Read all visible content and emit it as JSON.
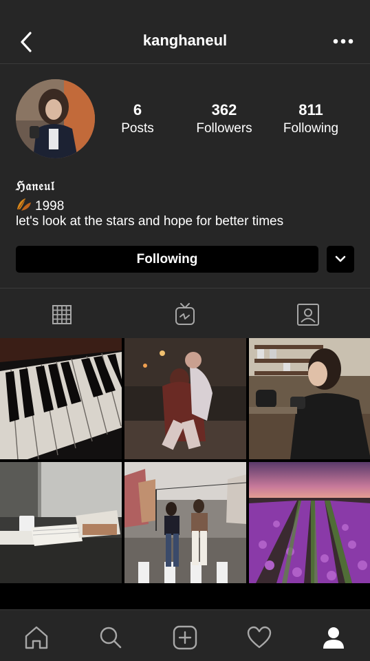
{
  "header": {
    "username": "kanghaneul",
    "back_icon": "chevron-left-icon",
    "more_icon": "more-horizontal-icon"
  },
  "profile": {
    "stats": [
      {
        "value": "6",
        "label": "Posts"
      },
      {
        "value": "362",
        "label": "Followers"
      },
      {
        "value": "811",
        "label": "Following"
      }
    ],
    "bio": {
      "name": "ℌ𝔞𝔫𝔢𝔲𝔩",
      "birth_year_line": "1998",
      "bio_emoji": "fallen-leaf-emoji",
      "tagline": "let's look at the stars and hope for better times"
    },
    "follow_button_label": "Following",
    "dropdown_icon": "chevron-down-icon"
  },
  "tabs": [
    {
      "name": "grid",
      "icon": "grid-icon"
    },
    {
      "name": "igtv",
      "icon": "igtv-icon"
    },
    {
      "name": "tagged",
      "icon": "tagged-icon"
    }
  ],
  "posts": [
    {
      "subject": "piano-keys"
    },
    {
      "subject": "couple-piggyback-night"
    },
    {
      "subject": "girl-drinking-coffee"
    },
    {
      "subject": "desk-with-papers"
    },
    {
      "subject": "two-girls-street"
    },
    {
      "subject": "purple-flower-field"
    }
  ],
  "bottom_nav": [
    {
      "name": "home",
      "icon": "home-icon"
    },
    {
      "name": "search",
      "icon": "search-icon"
    },
    {
      "name": "new-post",
      "icon": "plus-square-icon"
    },
    {
      "name": "activity",
      "icon": "heart-icon"
    },
    {
      "name": "profile",
      "icon": "profile-icon",
      "active": true
    }
  ],
  "colors": {
    "background": "#262626",
    "button": "#000000",
    "text": "#ffffff",
    "icon_inactive": "#a8a8a8"
  }
}
